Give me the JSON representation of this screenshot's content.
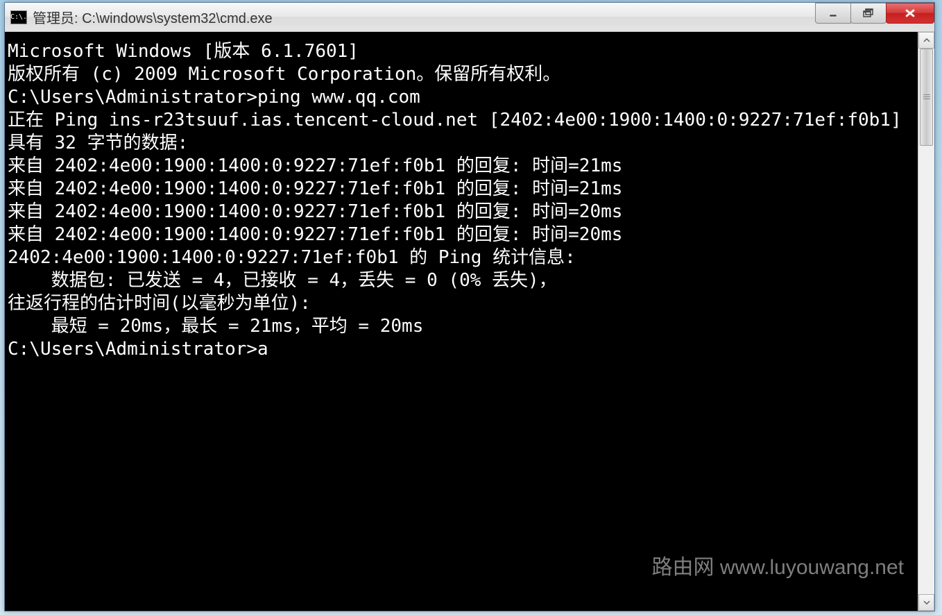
{
  "titlebar": {
    "icon_text": "C:\\.",
    "title": "管理员: C:\\windows\\system32\\cmd.exe"
  },
  "terminal": {
    "line1": "Microsoft Windows [版本 6.1.7601]",
    "line2": "版权所有 (c) 2009 Microsoft Corporation。保留所有权利。",
    "line3": "",
    "line4": "C:\\Users\\Administrator>ping www.qq.com",
    "line5": "",
    "line6": "正在 Ping ins-r23tsuuf.ias.tencent-cloud.net [2402:4e00:1900:1400:0:9227:71ef:f0b1] 具有 32 字节的数据:",
    "line7": "来自 2402:4e00:1900:1400:0:9227:71ef:f0b1 的回复: 时间=21ms",
    "line8": "来自 2402:4e00:1900:1400:0:9227:71ef:f0b1 的回复: 时间=21ms",
    "line9": "来自 2402:4e00:1900:1400:0:9227:71ef:f0b1 的回复: 时间=20ms",
    "line10": "来自 2402:4e00:1900:1400:0:9227:71ef:f0b1 的回复: 时间=20ms",
    "line11": "",
    "line12": "2402:4e00:1900:1400:0:9227:71ef:f0b1 的 Ping 统计信息:",
    "line13": "    数据包: 已发送 = 4，已接收 = 4，丢失 = 0 (0% 丢失)，",
    "line14": "往返行程的估计时间(以毫秒为单位):",
    "line15": "    最短 = 20ms，最长 = 21ms，平均 = 20ms",
    "line16": "",
    "line17": "C:\\Users\\Administrator>a"
  },
  "watermark": {
    "text": "路由网 www.luyouwang.net"
  }
}
